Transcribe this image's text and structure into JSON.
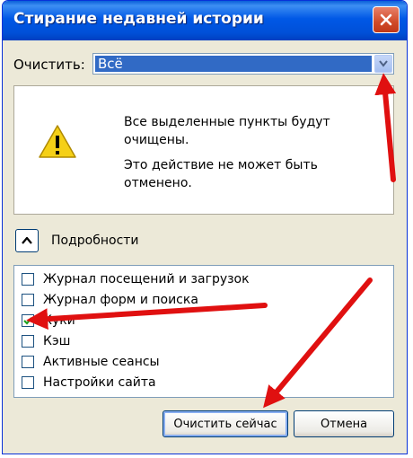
{
  "window": {
    "title": "Стирание недавней истории"
  },
  "clear": {
    "label": "Очистить:",
    "selected": "Всё"
  },
  "warning": {
    "line1": "Все выделенные пункты будут очищены.",
    "line2": "Это действие не может быть отменено."
  },
  "details": {
    "label": "Подробности"
  },
  "items": [
    {
      "label": "Журнал посещений и загрузок",
      "checked": false
    },
    {
      "label": "Журнал форм и поиска",
      "checked": false
    },
    {
      "label": "Куки",
      "checked": true
    },
    {
      "label": "Кэш",
      "checked": false
    },
    {
      "label": "Активные сеансы",
      "checked": false
    },
    {
      "label": "Настройки сайта",
      "checked": false
    }
  ],
  "buttons": {
    "clear_now": "Очистить сейчас",
    "cancel": "Отмена"
  },
  "colors": {
    "titlebar": "#0058e6",
    "selection": "#316ac5",
    "annotation_arrow": "#e01010",
    "check": "#21a121"
  }
}
